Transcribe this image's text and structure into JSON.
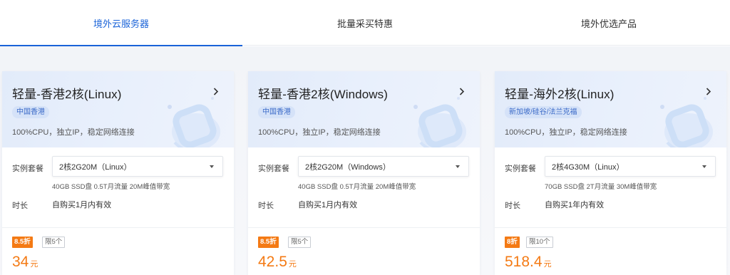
{
  "tabs": [
    {
      "label": "境外云服务器",
      "active": true
    },
    {
      "label": "批量采买特惠",
      "active": false
    },
    {
      "label": "境外优选产品",
      "active": false
    }
  ],
  "colors": {
    "accent": "#1a63d8",
    "price": "#f47a14",
    "tag_bg": "#d5e2f8"
  },
  "cards": [
    {
      "title": "轻量-香港2核(Linux)",
      "region": "中国香港",
      "desc": "100%CPU，独立IP，稳定网络连接",
      "package_label": "实例套餐",
      "package_value": "2核2G20M（Linux）",
      "spec": "40GB SSD盘 0.5T月流量 20M峰值带宽",
      "duration_label": "时长",
      "duration_value": "自购买1月内有效",
      "discount": "8.5折",
      "limit": "限5个",
      "price": "34",
      "unit": "元",
      "chevron_icon": "chevron-right-icon"
    },
    {
      "title": "轻量-香港2核(Windows)",
      "region": "中国香港",
      "desc": "100%CPU，独立IP，稳定网络连接",
      "package_label": "实例套餐",
      "package_value": "2核2G20M（Windows）",
      "spec": "40GB SSD盘 0.5T月流量 20M峰值带宽",
      "duration_label": "时长",
      "duration_value": "自购买1月内有效",
      "discount": "8.5折",
      "limit": "限5个",
      "price": "42.5",
      "unit": "元",
      "chevron_icon": "chevron-right-icon"
    },
    {
      "title": "轻量-海外2核(Linux)",
      "region": "新加坡/硅谷/法兰克福",
      "desc": "100%CPU，独立IP，稳定网络连接",
      "package_label": "实例套餐",
      "package_value": "2核4G30M（Linux）",
      "spec": "70GB SSD盘 2T月流量 30M峰值带宽",
      "duration_label": "时长",
      "duration_value": "自购买1年内有效",
      "discount": "8折",
      "limit": "限10个",
      "price": "518.4",
      "unit": "元",
      "chevron_icon": "chevron-right-icon"
    }
  ]
}
